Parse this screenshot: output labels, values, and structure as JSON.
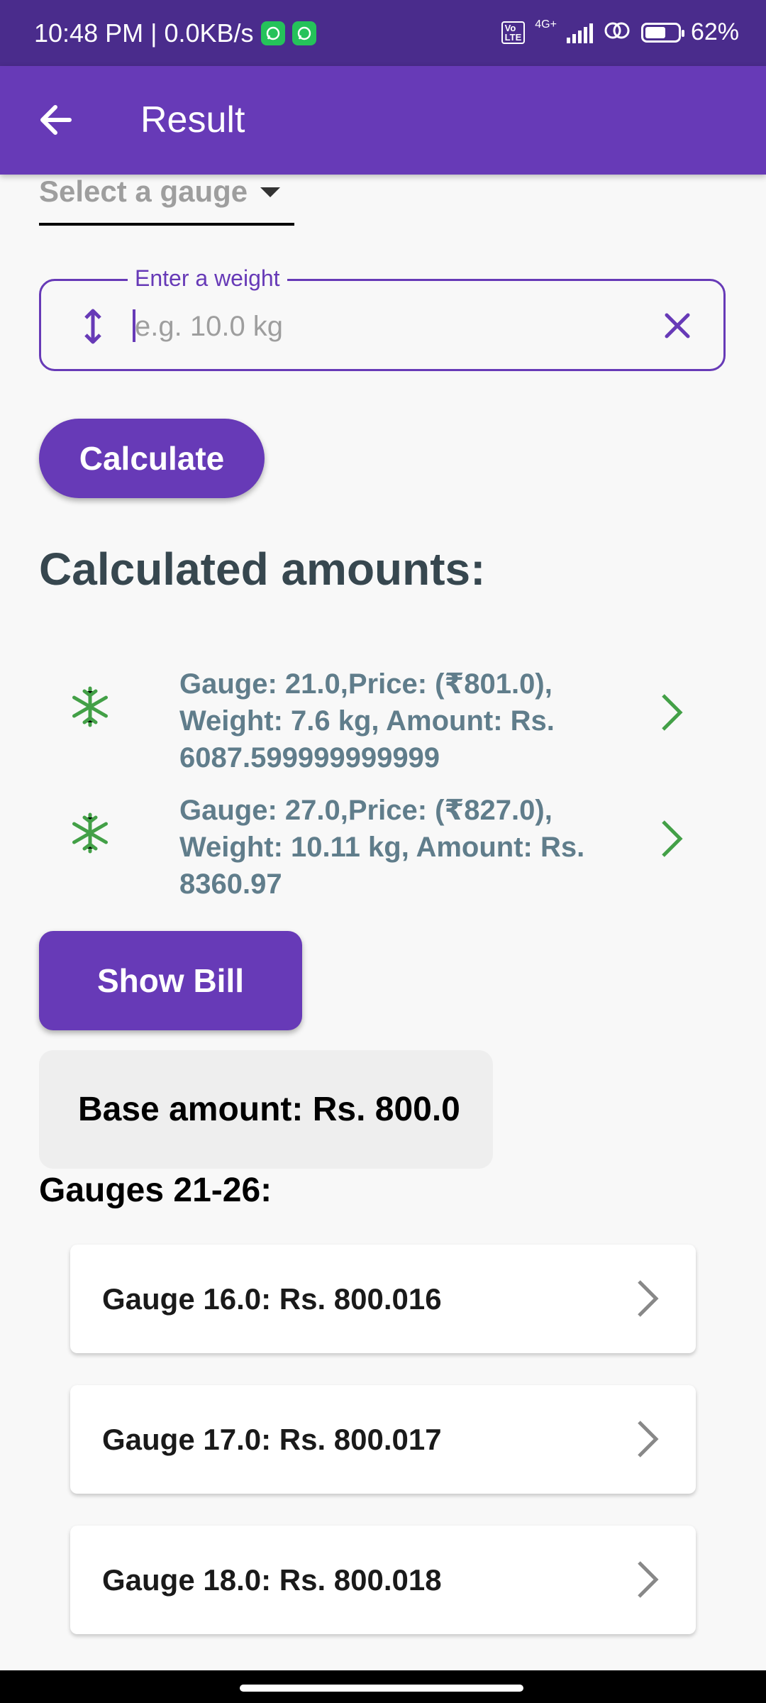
{
  "status_bar": {
    "time_speed": "10:48 PM | 0.0KB/s",
    "network": "4G+",
    "battery": "62%",
    "battery_level": 0.62
  },
  "app_bar": {
    "title": "Result",
    "back_icon": "arrow-left-icon"
  },
  "form": {
    "gauge_select_label": "Select a gauge",
    "weight_label": "Enter a weight",
    "weight_placeholder": "e.g. 10.0 kg",
    "weight_value": "",
    "calculate_label": "Calculate"
  },
  "results": {
    "heading": "Calculated amounts:",
    "items": [
      {
        "text": "Gauge: 21.0,Price: (₹801.0), Weight: 7.6 kg, Amount: Rs. 6087.599999999999",
        "icon": "snowflake-icon"
      },
      {
        "text": "Gauge: 27.0,Price: (₹827.0), Weight: 10.11 kg, Amount: Rs. 8360.97",
        "icon": "snowflake-icon"
      }
    ]
  },
  "show_bill_label": "Show Bill",
  "base_amount": "Base amount: Rs. 800.0",
  "gauges_heading": "Gauges 21-26:",
  "gauges": [
    {
      "label": "Gauge 16.0: Rs. 800.016"
    },
    {
      "label": "Gauge 17.0: Rs. 800.017"
    },
    {
      "label": "Gauge 18.0: Rs. 800.018"
    }
  ],
  "colors": {
    "primary": "#673ab7",
    "status_bar": "#4a2c8c",
    "accent_green": "#43a047",
    "result_text": "#607d8b"
  }
}
